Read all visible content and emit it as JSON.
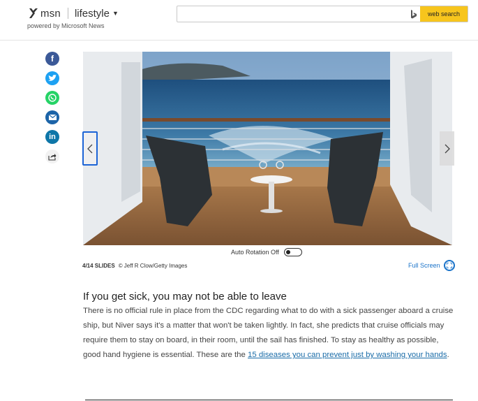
{
  "header": {
    "logo_text": "msn",
    "section": "lifestyle",
    "powered_by": "powered by Microsoft News",
    "search_placeholder": "",
    "search_button": "web search"
  },
  "social": [
    "facebook-icon",
    "twitter-icon",
    "whatsapp-icon",
    "email-icon",
    "linkedin-icon",
    "share-icon"
  ],
  "slideshow": {
    "auto_rotation_label": "Auto Rotation Off",
    "auto_rotation_on": false,
    "slide_count": "4/14 SLIDES",
    "credit": "© Jeff R Clow/Getty Images",
    "fullscreen_label": "Full Screen"
  },
  "article": {
    "headline": "If you get sick, you may not be able to leave",
    "paragraph_text": "There is no official rule in place from the CDC regarding what to do with a sick passenger aboard a cruise ship, but Niver says it's a matter that won't be taken lightly. In fact, she predicts that cruise officials may require them to stay on board, in their room, until the sail has finished. To stay as healthy as possible, good hand hygiene is essential. These are the ",
    "link_text": "15 diseases you can prevent just by washing your hands",
    "paragraph_end": "."
  },
  "colors": {
    "accent_yellow": "#f7c51d",
    "link_blue": "#1a6ca8",
    "facebook": "#3b5998",
    "twitter": "#1da1f2",
    "whatsapp": "#25d366",
    "linkedin": "#0e76a8"
  }
}
